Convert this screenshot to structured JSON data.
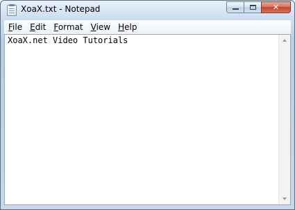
{
  "window": {
    "title": "XoaX.txt - Notepad",
    "icon": "notepad-icon",
    "caption_buttons": [
      {
        "name": "minimize",
        "icon": "minimize-icon"
      },
      {
        "name": "maximize",
        "icon": "maximize-icon"
      },
      {
        "name": "close",
        "icon": "close-icon",
        "glyph": "✕"
      }
    ]
  },
  "menu": {
    "items": [
      {
        "accel": "F",
        "rest": "ile"
      },
      {
        "accel": "E",
        "rest": "dit"
      },
      {
        "accel": "F",
        "rest": "ormat"
      },
      {
        "accel": "V",
        "rest": "iew"
      },
      {
        "accel": "H",
        "rest": "elp"
      }
    ]
  },
  "editor": {
    "content": "XoaX.net Video Tutorials"
  },
  "colors": {
    "close_button": "#c7442b",
    "titlebar": "#c9dbee"
  }
}
